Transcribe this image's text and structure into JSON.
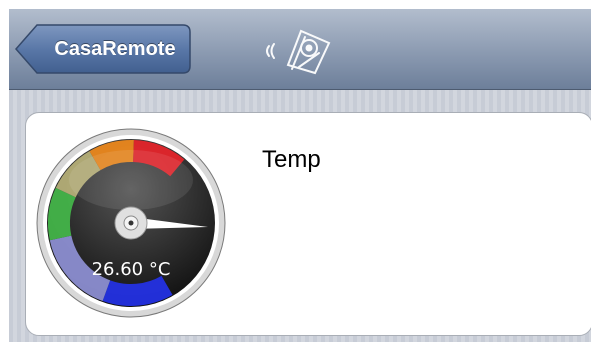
{
  "navbar": {
    "back_label": "CasaRemote",
    "logo_icon": "remote-control-signal-icon"
  },
  "widget": {
    "title": "Temp",
    "reading": "26.60 °C",
    "value": 26.6,
    "unit": "°C",
    "gauge_icon": "temperature-gauge-icon"
  },
  "colors": {
    "navbar": "#8b9ab1",
    "zone_blue": "#2432e8",
    "zone_lavender": "#8f91d6",
    "zone_green": "#44b84a",
    "zone_khaki": "#b8b27a",
    "zone_orange": "#f08a1c",
    "zone_red": "#e8242a"
  }
}
